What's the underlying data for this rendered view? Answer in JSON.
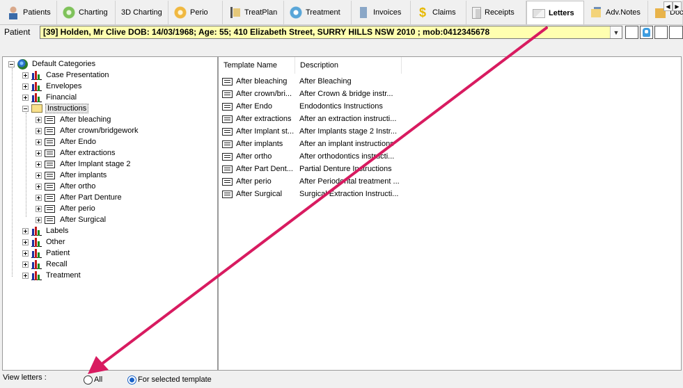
{
  "tabs": [
    {
      "label": "Patients",
      "icon": "patients-icon",
      "active": false
    },
    {
      "label": "Charting",
      "icon": "charting-icon",
      "active": false
    },
    {
      "label": "3D Charting",
      "icon": "",
      "active": false
    },
    {
      "label": "Perio",
      "icon": "perio-icon",
      "active": false
    },
    {
      "label": "TreatPlan",
      "icon": "treatplan-icon",
      "active": false
    },
    {
      "label": "Treatment",
      "icon": "treatment-icon",
      "active": false
    },
    {
      "label": "Invoices",
      "icon": "invoices-icon",
      "active": false
    },
    {
      "label": "Claims",
      "icon": "claims-icon",
      "active": false
    },
    {
      "label": "Receipts",
      "icon": "receipts-icon",
      "active": false
    },
    {
      "label": "Letters",
      "icon": "letters-icon",
      "active": true
    },
    {
      "label": "Adv.Notes",
      "icon": "advnotes-icon",
      "active": false
    },
    {
      "label": "Doc",
      "icon": "docs-icon",
      "active": false
    }
  ],
  "patient": {
    "label": "Patient",
    "value": "[39] Holden, Mr Clive DOB: 14/03/1968; Age: 55; 410 Elizabeth Street, SURRY HILLS NSW 2010 ; mob:0412345678"
  },
  "tree": {
    "root": "Default Categories",
    "categories_before": [
      "Case Presentation",
      "Envelopes",
      "Financial"
    ],
    "open_category": "Instructions",
    "templates": [
      "After bleaching",
      "After crown/bridgework",
      "After Endo",
      "After extractions",
      "After Implant stage 2",
      "After implants",
      "After ortho",
      "After Part Denture",
      "After perio",
      "After Surgical"
    ],
    "categories_after": [
      "Labels",
      "Other",
      "Patient",
      "Recall",
      "Treatment"
    ]
  },
  "list": {
    "columns": [
      "Template Name",
      "Description"
    ],
    "rows": [
      {
        "name": "After bleaching",
        "desc": "After Bleaching"
      },
      {
        "name": "After crown/bri...",
        "desc": "After Crown & bridge instr..."
      },
      {
        "name": "After Endo",
        "desc": "Endodontics Instructions"
      },
      {
        "name": "After extractions",
        "desc": "After an extraction instructi..."
      },
      {
        "name": "After Implant st...",
        "desc": "After Implants stage 2 Instr..."
      },
      {
        "name": "After implants",
        "desc": "After an implant instructions"
      },
      {
        "name": "After ortho",
        "desc": "After orthodontics instructi..."
      },
      {
        "name": "After Part Dent...",
        "desc": "Partial Denture Instructions"
      },
      {
        "name": "After perio",
        "desc": "After Periodontal treatment ..."
      },
      {
        "name": "After Surgical",
        "desc": "Surgical Extraction Instructi..."
      }
    ]
  },
  "view_letters": {
    "label": "View letters :",
    "options": [
      {
        "label": "All",
        "checked": false
      },
      {
        "label": "For selected template",
        "checked": true
      }
    ]
  },
  "annotation_color": "#d81b60"
}
